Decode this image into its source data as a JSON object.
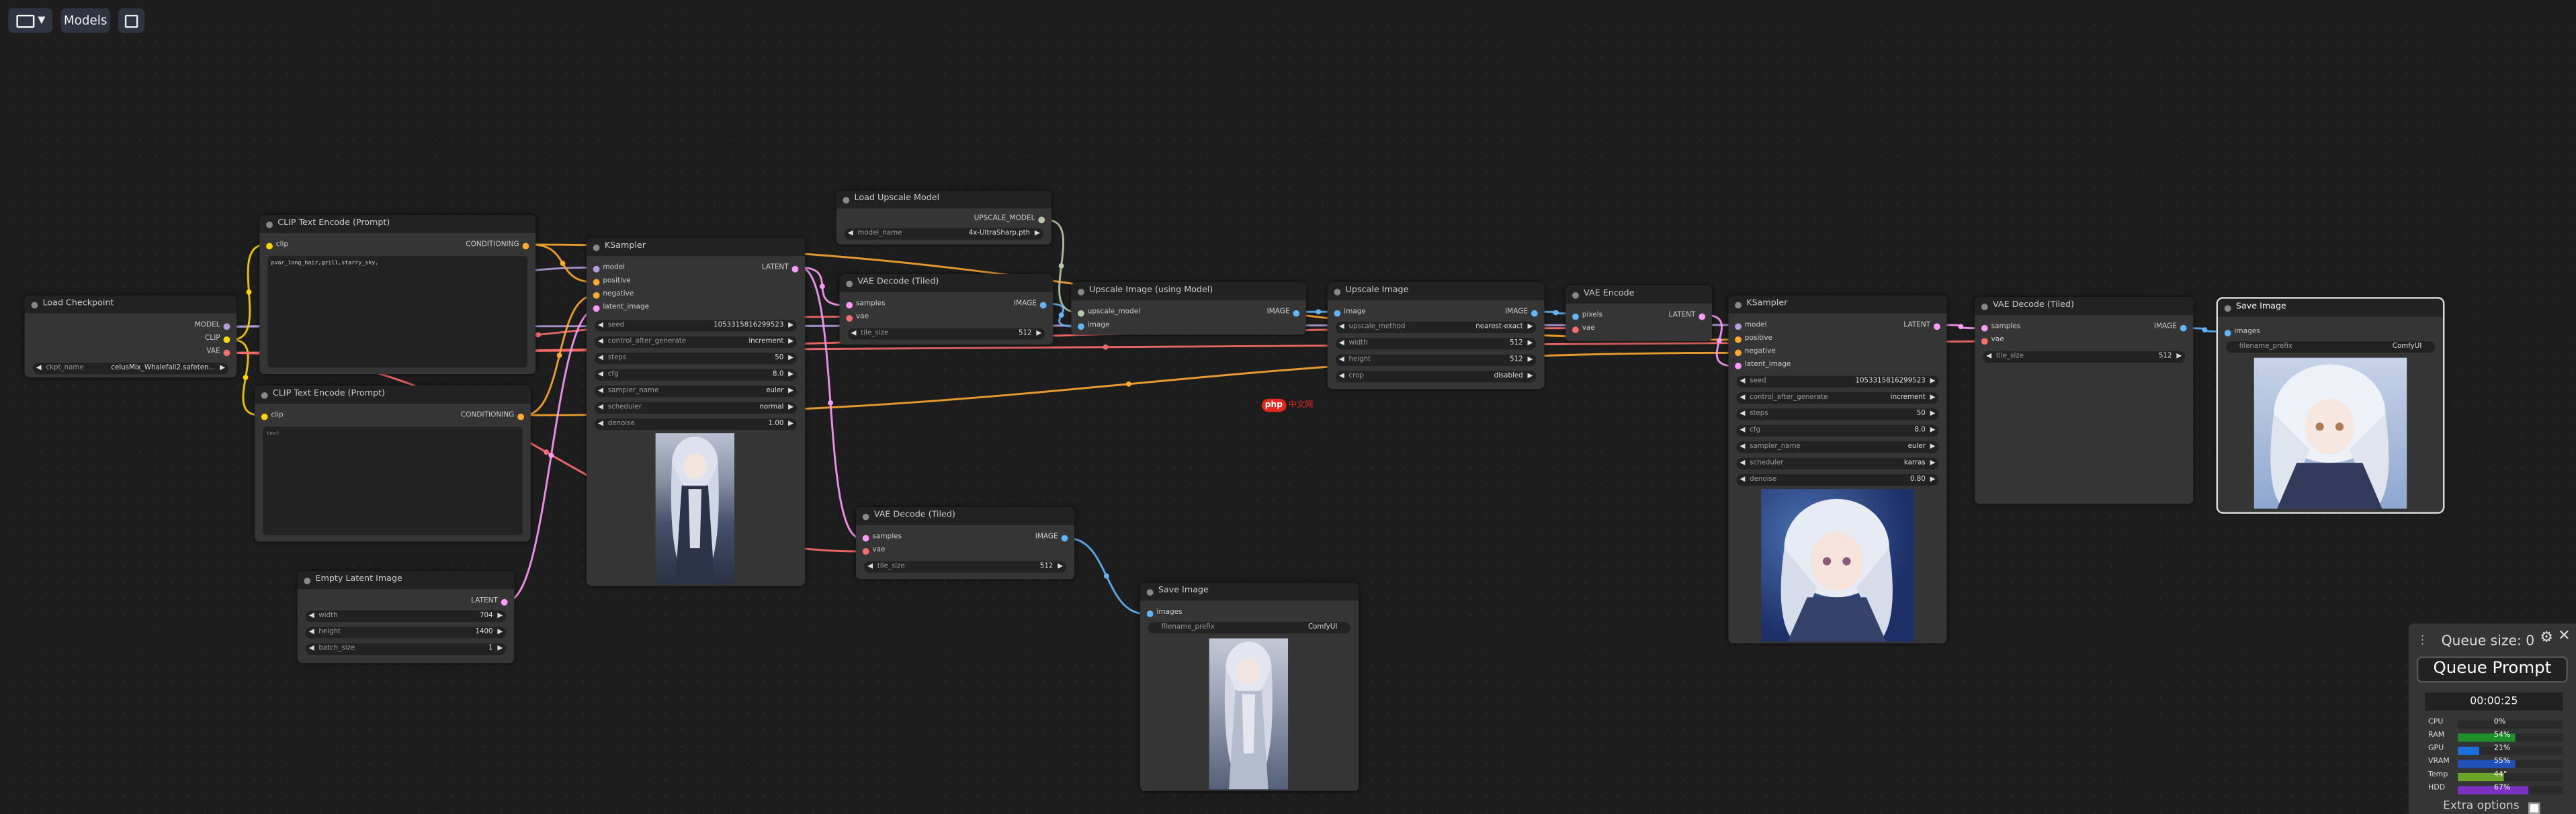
{
  "toolbar": {
    "folder_icon": "folder-icon",
    "models_label": "Models",
    "save_icon": "floppy-disk-icon"
  },
  "nodes": {
    "load_checkpoint": {
      "title": "Load Checkpoint",
      "outputs": [
        "MODEL",
        "CLIP",
        "VAE"
      ],
      "widgets": [
        {
          "label": "ckpt_name",
          "value": "celusMix_Whalefall2.safeten..."
        }
      ]
    },
    "clip_pos": {
      "title": "CLIP Text Encode (Prompt)",
      "input": "clip",
      "output": "CONDITIONING",
      "text": "pvar_long_hair,grill,starry_sky,"
    },
    "clip_neg": {
      "title": "CLIP Text Encode (Prompt)",
      "input": "clip",
      "output": "CONDITIONING",
      "text": "text"
    },
    "empty_latent": {
      "title": "Empty Latent Image",
      "output": "LATENT",
      "widgets": [
        {
          "label": "width",
          "value": "704"
        },
        {
          "label": "height",
          "value": "1400"
        },
        {
          "label": "batch_size",
          "value": "1"
        }
      ]
    },
    "ksampler1": {
      "title": "KSampler",
      "inputs": [
        "model",
        "positive",
        "negative",
        "latent_image"
      ],
      "output": "LATENT",
      "widgets": [
        {
          "label": "seed",
          "value": "1053315816299523"
        },
        {
          "label": "control_after_generate",
          "value": "increment"
        },
        {
          "label": "steps",
          "value": "50"
        },
        {
          "label": "cfg",
          "value": "8.0"
        },
        {
          "label": "sampler_name",
          "value": "euler"
        },
        {
          "label": "scheduler",
          "value": "normal"
        },
        {
          "label": "denoise",
          "value": "1.00"
        }
      ]
    },
    "load_upscale": {
      "title": "Load Upscale Model",
      "output": "UPSCALE_MODEL",
      "widgets": [
        {
          "label": "model_name",
          "value": "4x-UltraSharp.pth"
        }
      ]
    },
    "vae_decode_1": {
      "title": "VAE Decode (Tiled)",
      "inputs": [
        "samples",
        "vae"
      ],
      "output": "IMAGE",
      "widgets": [
        {
          "label": "tile_size",
          "value": "512"
        }
      ]
    },
    "vae_decode_2": {
      "title": "VAE Decode (Tiled)",
      "inputs": [
        "samples",
        "vae"
      ],
      "output": "IMAGE",
      "widgets": [
        {
          "label": "tile_size",
          "value": "512"
        }
      ]
    },
    "upscale_model": {
      "title": "Upscale Image (using Model)",
      "inputs": [
        "upscale_model",
        "image"
      ],
      "output": "IMAGE"
    },
    "upscale_image": {
      "title": "Upscale Image",
      "input": "image",
      "output": "IMAGE",
      "widgets": [
        {
          "label": "upscale_method",
          "value": "nearest-exact"
        },
        {
          "label": "width",
          "value": "512"
        },
        {
          "label": "height",
          "value": "512"
        },
        {
          "label": "crop",
          "value": "disabled"
        }
      ]
    },
    "vae_encode": {
      "title": "VAE Encode",
      "inputs": [
        "pixels",
        "vae"
      ],
      "output": "LATENT"
    },
    "ksampler2": {
      "title": "KSampler",
      "inputs": [
        "model",
        "positive",
        "negative",
        "latent_image"
      ],
      "output": "LATENT",
      "widgets": [
        {
          "label": "seed",
          "value": "1053315816299523"
        },
        {
          "label": "control_after_generate",
          "value": "increment"
        },
        {
          "label": "steps",
          "value": "50"
        },
        {
          "label": "cfg",
          "value": "8.0"
        },
        {
          "label": "sampler_name",
          "value": "euler"
        },
        {
          "label": "scheduler",
          "value": "karras"
        },
        {
          "label": "denoise",
          "value": "0.80"
        }
      ]
    },
    "vae_decode_3": {
      "title": "VAE Decode (Tiled)",
      "inputs": [
        "samples",
        "vae"
      ],
      "output": "IMAGE",
      "widgets": [
        {
          "label": "tile_size",
          "value": "512"
        }
      ]
    },
    "save_image_1": {
      "title": "Save Image",
      "input": "images",
      "widgets": [
        {
          "label": "filename_prefix",
          "value": "ComfyUI"
        }
      ]
    },
    "save_image_2": {
      "title": "Save Image",
      "input": "images",
      "widgets": [
        {
          "label": "filename_prefix",
          "value": "ComfyUI"
        }
      ]
    }
  },
  "watermark": {
    "badge": "php",
    "text": "中文网"
  },
  "queue_panel": {
    "queue_size_label": "Queue size: 0",
    "queue_button": "Queue Prompt",
    "timer": "00:00:25",
    "extra_options": "Extra options",
    "stats": [
      {
        "label": "CPU",
        "value": "0%",
        "fraction": 0.0,
        "color": "#2aa02a"
      },
      {
        "label": "RAM",
        "value": "54%",
        "fraction": 0.54,
        "color": "#1e8f2a"
      },
      {
        "label": "GPU",
        "value": "21%",
        "fraction": 0.21,
        "color": "#1e6fd9"
      },
      {
        "label": "VRAM",
        "value": "55%",
        "fraction": 0.55,
        "color": "#2050b8"
      },
      {
        "label": "Temp",
        "value": "44°",
        "fraction": 0.44,
        "color": "#6aa52a"
      },
      {
        "label": "HDD",
        "value": "67%",
        "fraction": 0.67,
        "color": "#7d2fc0"
      }
    ]
  },
  "colors": {
    "model": "#b39ddb",
    "clip": "#ffd500",
    "vae": "#ff6e6e",
    "conditioning": "#ffa931",
    "latent": "#ff9cf9",
    "image": "#64b5f6",
    "upscale_model": "#b7c8a8"
  }
}
